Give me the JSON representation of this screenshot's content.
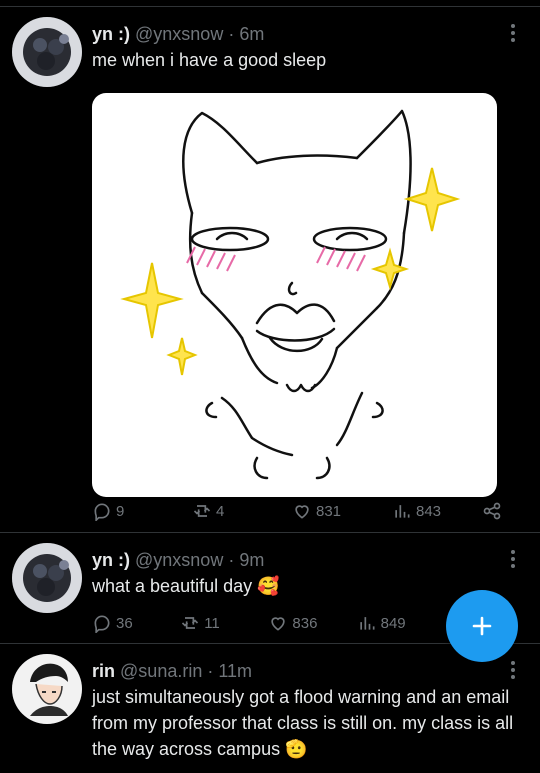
{
  "tweets": [
    {
      "name": "yn :)",
      "handle": "@ynxsnow",
      "dot": "·",
      "time": "6m",
      "text": "me when i have a good sleep",
      "replies": "9",
      "retweets": "4",
      "likes": "831",
      "views": "843",
      "media_description": "cat doodle"
    },
    {
      "name": "yn :)",
      "handle": "@ynxsnow",
      "dot": "·",
      "time": "9m",
      "text": "what a beautiful day 🥰",
      "replies": "36",
      "retweets": "11",
      "likes": "836",
      "views": "849"
    },
    {
      "name": "rin",
      "handle": "@suna.rin",
      "dot": "·",
      "time": "11m",
      "text": "just simultaneously got a flood warning and an email from my professor that class is still on. my class is all the way across campus 🫡"
    }
  ],
  "colors": {
    "background": "#000000",
    "text": "#e7e9ea",
    "muted": "#71767b",
    "divider": "#2f3336",
    "accent": "#1d9bf0"
  },
  "icons": [
    "reply-icon",
    "retweet-icon",
    "like-icon",
    "views-icon",
    "share-icon",
    "more-icon",
    "compose-icon"
  ]
}
